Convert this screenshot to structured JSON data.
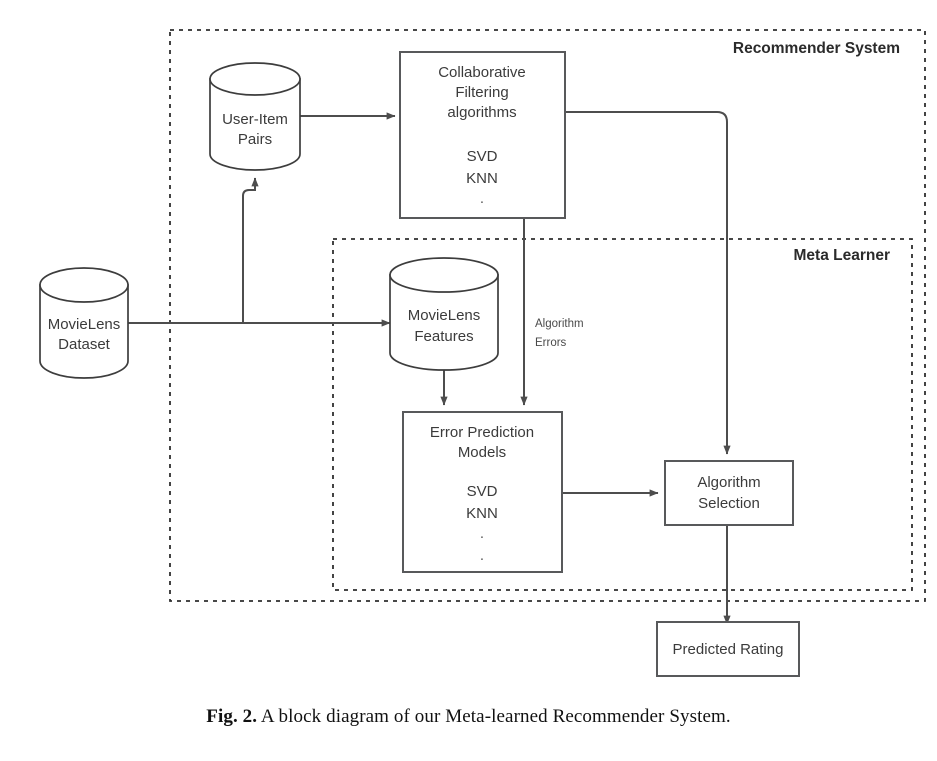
{
  "figure": {
    "caption_prefix": "Fig. 2.",
    "caption_text": "A block diagram of our Meta-learned Recommender System."
  },
  "containers": [
    {
      "id": "recommender-system",
      "label": "Recommender System"
    },
    {
      "id": "meta-learner",
      "label": "Meta Learner"
    }
  ],
  "nodes": {
    "movielens_dataset": {
      "line1": "MovieLens",
      "line2": "Dataset"
    },
    "user_item_pairs": {
      "line1": "User-Item",
      "line2": "Pairs"
    },
    "collaborative_filtering": {
      "line1": "Collaborative",
      "line2": "Filtering",
      "line3": "algorithms",
      "alg1": "SVD",
      "alg2": "KNN",
      "ellipsis": "."
    },
    "movielens_features": {
      "line1": "MovieLens",
      "line2": "Features"
    },
    "error_prediction_models": {
      "line1": "Error Prediction",
      "line2": "Models",
      "alg1": "SVD",
      "alg2": "KNN",
      "ellipsis1": ".",
      "ellipsis2": "."
    },
    "algorithm_selection": {
      "line1": "Algorithm",
      "line2": "Selection"
    },
    "predicted_rating": {
      "line1": "Predicted Rating"
    }
  },
  "edges": {
    "algorithm_errors": {
      "line1": "Algorithm",
      "line2": "Errors"
    }
  },
  "colors": {
    "box_stroke": "#58595b",
    "cylinder_stroke": "#3d3d3d",
    "connector": "#4d4d4d",
    "dashed_container": "#2f2f2f",
    "text": "#3b3b3b",
    "background": "#ffffff"
  }
}
